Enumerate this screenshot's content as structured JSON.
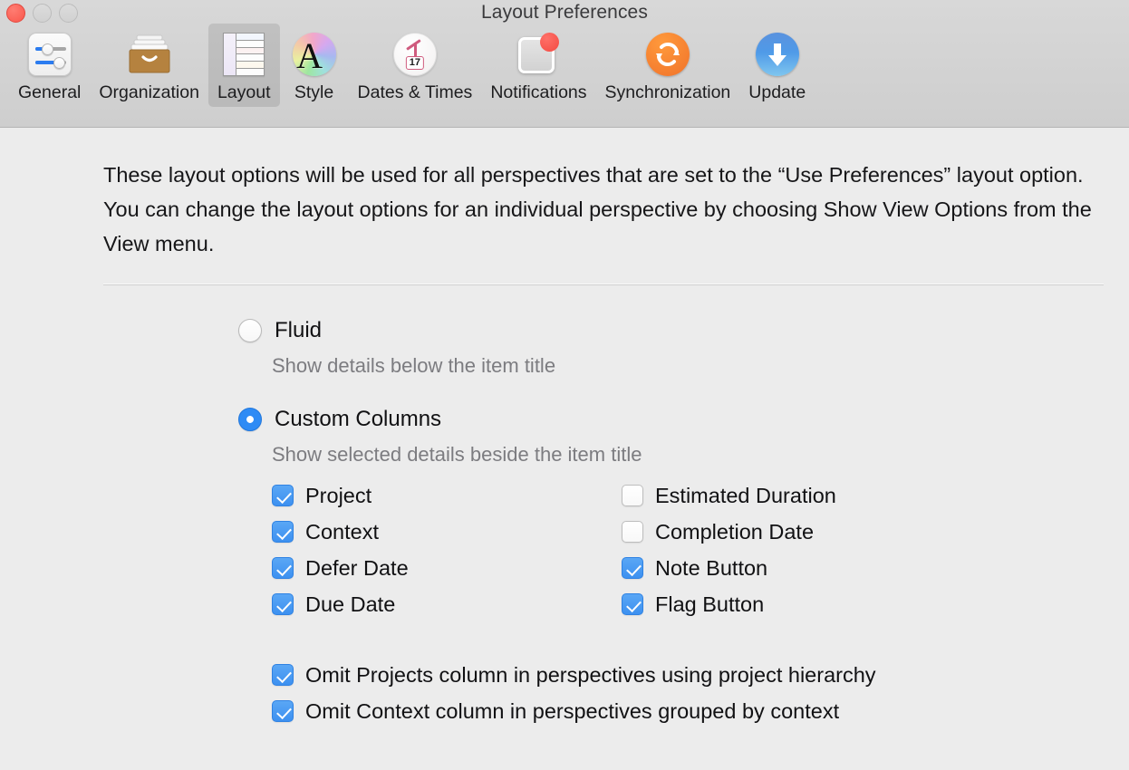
{
  "window": {
    "title": "Layout Preferences",
    "traffic_lights": [
      {
        "name": "close",
        "color": "#f9574c"
      },
      {
        "name": "minimize",
        "color": "#d4d4d4"
      },
      {
        "name": "maximize",
        "color": "#d4d4d4"
      }
    ]
  },
  "toolbar": {
    "selected": "Layout",
    "tabs": [
      {
        "label": "General",
        "icon": "sliders-icon"
      },
      {
        "label": "Organization",
        "icon": "file-drawer-icon"
      },
      {
        "label": "Layout",
        "icon": "columns-layout-icon"
      },
      {
        "label": "Style",
        "icon": "font-color-wheel-icon"
      },
      {
        "label": "Dates & Times",
        "icon": "clock-calendar-icon"
      },
      {
        "label": "Notifications",
        "icon": "badge-window-icon"
      },
      {
        "label": "Synchronization",
        "icon": "refresh-circle-icon"
      },
      {
        "label": "Update",
        "icon": "download-arrow-icon"
      }
    ],
    "dates_badge_number": "17"
  },
  "main": {
    "intro": "These layout options will be used for all perspectives that are set to the “Use Preferences” layout option. You can change the layout options for an individual perspective by choosing Show View Options from the View menu.",
    "layout_mode": {
      "options": [
        {
          "label": "Fluid",
          "sub": "Show details below the item title",
          "selected": false
        },
        {
          "label": "Custom Columns",
          "sub": "Show selected details beside the item title",
          "selected": true
        }
      ]
    },
    "columns_left": [
      {
        "label": "Project",
        "checked": true
      },
      {
        "label": "Context",
        "checked": true
      },
      {
        "label": "Defer Date",
        "checked": true
      },
      {
        "label": "Due Date",
        "checked": true
      }
    ],
    "columns_right": [
      {
        "label": "Estimated Duration",
        "checked": false
      },
      {
        "label": "Completion Date",
        "checked": false
      },
      {
        "label": "Note Button",
        "checked": true
      },
      {
        "label": "Flag Button",
        "checked": true
      }
    ],
    "omit_options": [
      {
        "label": "Omit Projects column in perspectives using project hierarchy",
        "checked": true
      },
      {
        "label": "Omit Context column in perspectives grouped by context",
        "checked": true
      }
    ]
  },
  "colors": {
    "accent": "#3d91f0",
    "toolbar_bg": "#d4d4d4",
    "content_bg": "#ececec",
    "selected_tab_bg": "#c2c2c2",
    "subtext": "#7c7c80"
  }
}
